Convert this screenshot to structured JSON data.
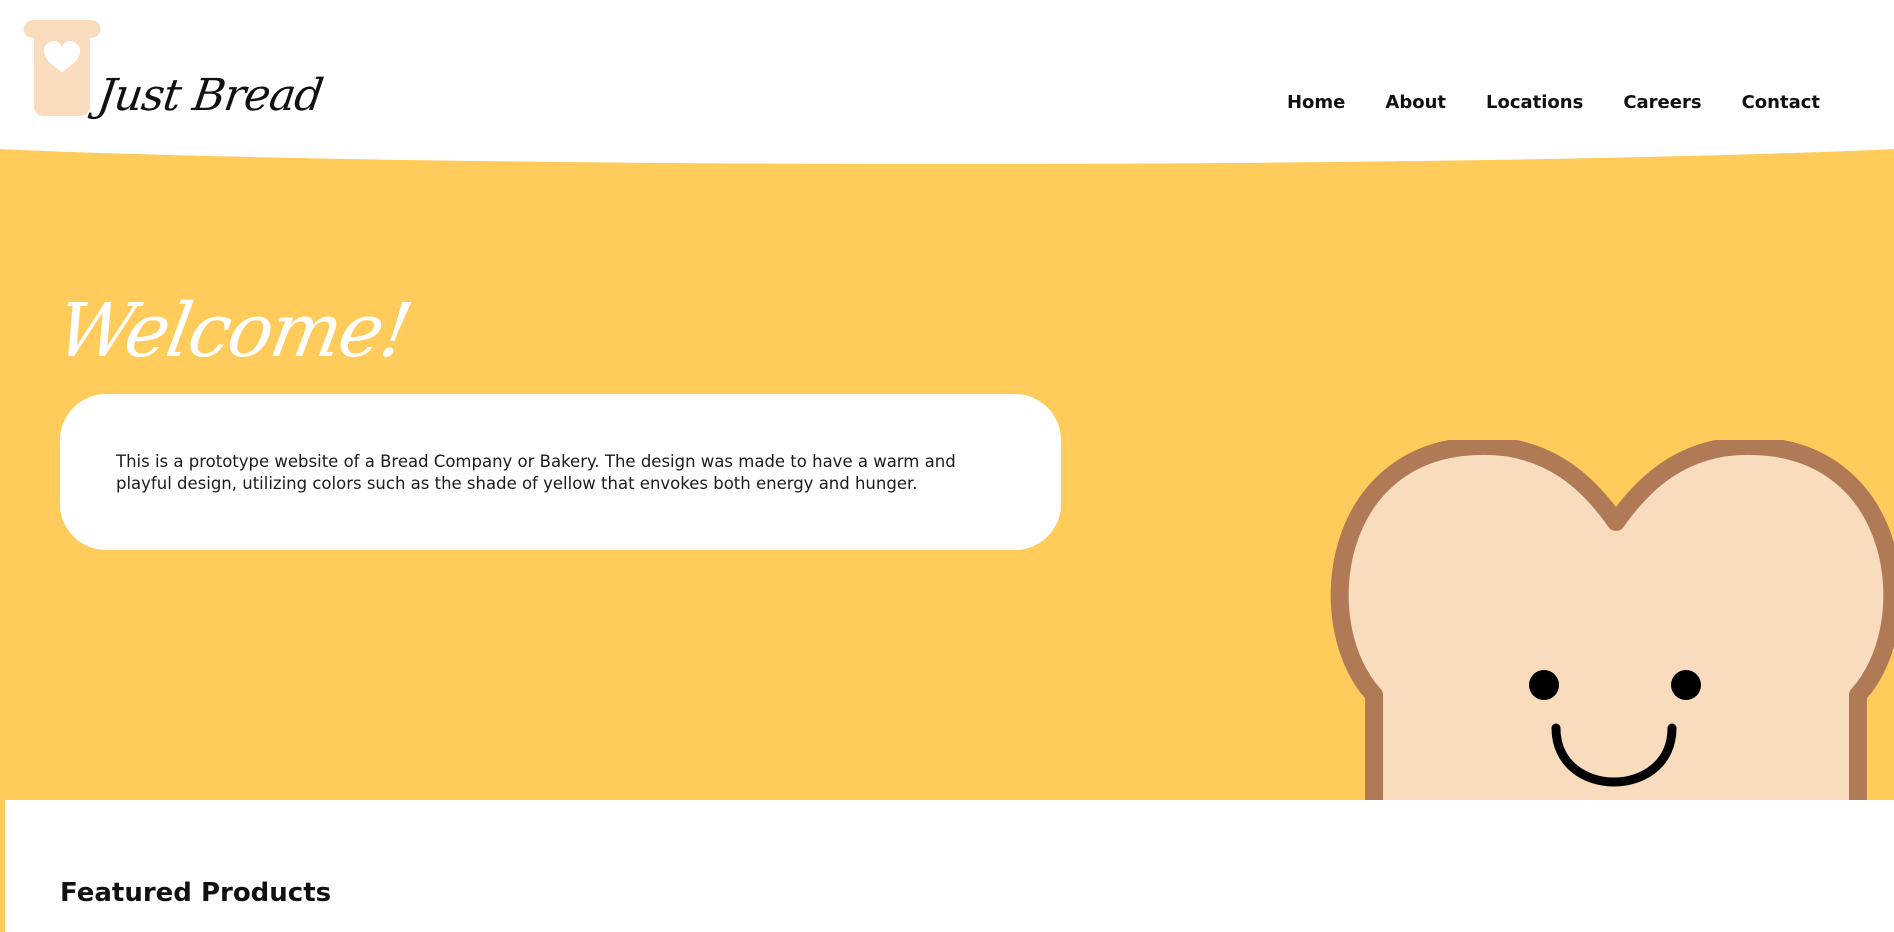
{
  "brand": {
    "name": "Just Bread"
  },
  "nav": {
    "items": [
      {
        "label": "Home"
      },
      {
        "label": "About"
      },
      {
        "label": "Locations"
      },
      {
        "label": "Careers"
      },
      {
        "label": "Contact"
      }
    ]
  },
  "hero": {
    "title": "Welcome!",
    "description": "This is a prototype website of a Bread Company or Bakery. The design was made to have a warm and playful design, utilizing colors such as the shade of yellow that envokes both energy and hunger."
  },
  "featured": {
    "title": "Featured Products"
  },
  "icons": {
    "logo": "bread-heart-icon",
    "mascot": "smiling-bread-mascot"
  },
  "colors": {
    "hero_background": "#FFCB5B",
    "bread_fill": "#F9DCBE",
    "bread_crust": "#B07A56",
    "text": "#111111",
    "white": "#FFFFFF"
  }
}
